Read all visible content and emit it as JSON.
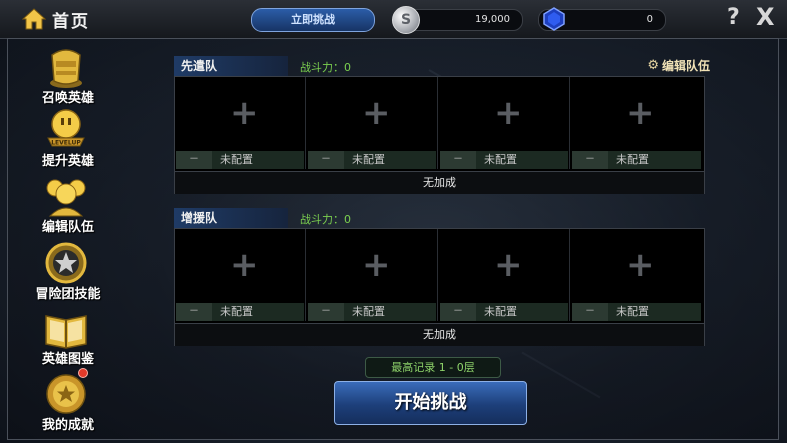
{
  "topbar": {
    "home_label": "首页",
    "challenge_label": "立即挑战",
    "coins": "19,000",
    "coin_symbol": "S",
    "gems": "0",
    "help": "?",
    "close": "X"
  },
  "sidebar": {
    "items": [
      {
        "label": "召唤英雄",
        "icon": "summon-hero-icon"
      },
      {
        "label": "提升英雄",
        "icon": "levelup-hero-icon",
        "icon_text": "LEVELUP"
      },
      {
        "label": "编辑队伍",
        "icon": "team-icon"
      },
      {
        "label": "冒险团技能",
        "icon": "adventure-skill-icon"
      },
      {
        "label": "英雄图鉴",
        "icon": "hero-book-icon"
      },
      {
        "label": "我的成就",
        "icon": "achievement-icon",
        "badge": true
      }
    ]
  },
  "vanguard": {
    "title": "先遣队",
    "power": "战斗力：0",
    "edit_label": "编辑队伍",
    "slots": [
      {
        "minus": "－",
        "status": "未配置"
      },
      {
        "minus": "－",
        "status": "未配置"
      },
      {
        "minus": "－",
        "status": "未配置"
      },
      {
        "minus": "－",
        "status": "未配置"
      }
    ],
    "bonus": "无加成"
  },
  "support": {
    "title": "增援队",
    "power": "战斗力：0",
    "slots": [
      {
        "minus": "－",
        "status": "未配置"
      },
      {
        "minus": "－",
        "status": "未配置"
      },
      {
        "minus": "－",
        "status": "未配置"
      },
      {
        "minus": "－",
        "status": "未配置"
      }
    ],
    "bonus": "无加成"
  },
  "record": "最高记录 1 - 0层",
  "start_label": "开始挑战",
  "colors": {
    "accent": "#1f3b66",
    "power": "#7bd04f",
    "button": "#2b5da8"
  }
}
